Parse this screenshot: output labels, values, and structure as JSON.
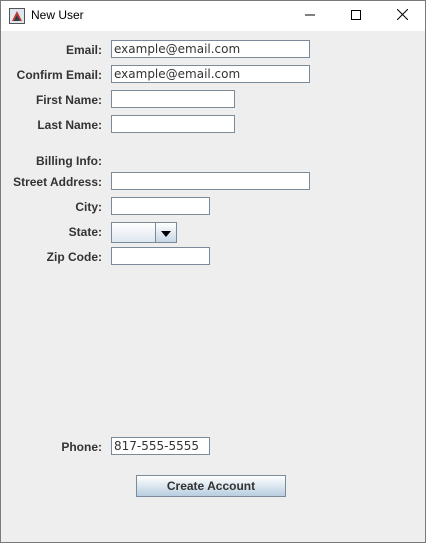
{
  "window": {
    "title": "New User",
    "icon": "java-app-icon",
    "controls": [
      "minimize-icon",
      "maximize-icon",
      "close-icon"
    ]
  },
  "form": {
    "email": {
      "label": "Email:",
      "value": "example@email.com"
    },
    "confirm_email": {
      "label": "Confirm Email:",
      "value": "example@email.com"
    },
    "first_name": {
      "label": "First Name:",
      "value": ""
    },
    "last_name": {
      "label": "Last Name:",
      "value": ""
    },
    "billing_header": "Billing Info:",
    "street_address": {
      "label": "Street Address:",
      "value": ""
    },
    "city": {
      "label": "City:",
      "value": ""
    },
    "state": {
      "label": "State:",
      "selected": ""
    },
    "zip_code": {
      "label": "Zip Code:",
      "value": ""
    },
    "phone": {
      "label": "Phone:",
      "value": "817-555-5555"
    },
    "submit_label": "Create Account"
  }
}
